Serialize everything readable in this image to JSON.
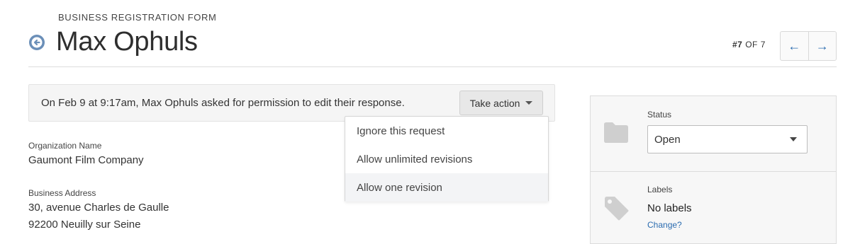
{
  "header": {
    "eyebrow": "BUSINESS REGISTRATION FORM",
    "title": "Max Ophuls",
    "counter_current": "#7",
    "counter_rest": "OF 7",
    "prev_arrow": "←",
    "next_arrow": "→"
  },
  "notice": {
    "text": "On Feb 9 at 9:17am, Max Ophuls asked for permission to edit their response.",
    "action_label": "Take action"
  },
  "action_menu": {
    "items": [
      {
        "label": "Ignore this request"
      },
      {
        "label": "Allow unlimited revisions"
      },
      {
        "label": "Allow one revision"
      }
    ],
    "highlighted_index": 2
  },
  "fields": {
    "org_label": "Organization Name",
    "org_value": "Gaumont Film Company",
    "address_label": "Business Address",
    "address_line1": "30, avenue Charles de Gaulle",
    "address_line2": "92200 Neuilly sur Seine"
  },
  "side_panel": {
    "status_label": "Status",
    "status_value": "Open",
    "labels_label": "Labels",
    "labels_value": "No labels",
    "change_link": "Change?"
  },
  "colors": {
    "accent": "#2b6cb0",
    "icon_gray": "#cfcfcf",
    "back_icon": "#6b8fb8"
  },
  "icons": [
    "back-arrow-circle-icon",
    "folder-icon",
    "tag-icon",
    "chevron-down-icon"
  ]
}
